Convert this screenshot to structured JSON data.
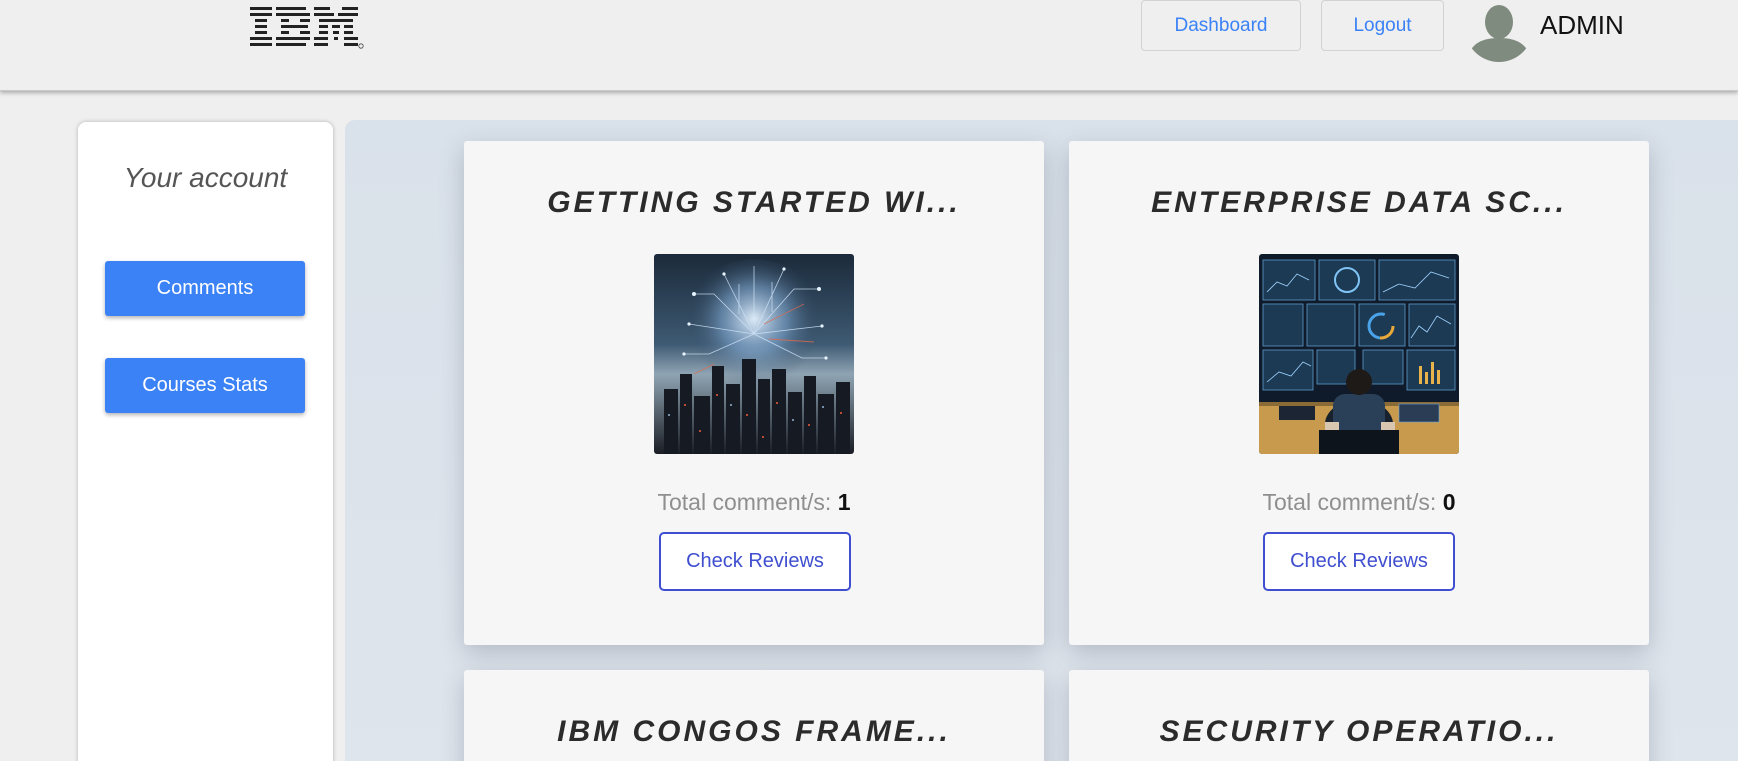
{
  "header": {
    "logo_text": "IBM",
    "nav": [
      {
        "label": "Dashboard"
      },
      {
        "label": "Logout"
      }
    ],
    "user": {
      "name": "ADMIN",
      "icon": "user-avatar-icon"
    }
  },
  "sidebar": {
    "title": "Your account",
    "buttons": [
      {
        "label": "Comments"
      },
      {
        "label": "Courses Stats"
      }
    ]
  },
  "courses": [
    {
      "title": "GETTING STARTED WI...",
      "comment_label": "Total comment/s: ",
      "comment_count": "1",
      "button": "Check Reviews",
      "image": "ai-city-circuit-image"
    },
    {
      "title": "ENTERPRISE DATA SC...",
      "comment_label": "Total comment/s: ",
      "comment_count": "0",
      "button": "Check Reviews",
      "image": "data-analyst-monitors-image"
    },
    {
      "title": "IBM CONGOS FRAME..."
    },
    {
      "title": "SECURITY OPERATIO..."
    }
  ],
  "colors": {
    "accent": "#3b82f6",
    "outline_button": "#3f4fd0",
    "page_bg": "#efefef",
    "main_bg": "#d9e1ea"
  }
}
